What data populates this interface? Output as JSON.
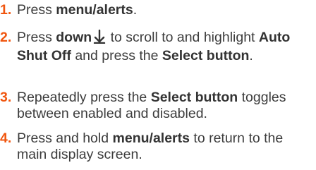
{
  "steps": [
    {
      "number": "1.",
      "text_a": "Press ",
      "bold_a": "menu/alerts",
      "text_b": "."
    },
    {
      "number": "2.",
      "text_a": "Press ",
      "bold_a": "down",
      "icon": "down-arrow-icon",
      "text_b": " to scroll to and highlight ",
      "bold_b": "Auto Shut Off",
      "text_c": " and press the ",
      "bold_c": "Select button",
      "text_d": "."
    },
    {
      "number": "3.",
      "text_a": "Repeatedly press the ",
      "bold_a": "Select button",
      "text_b": " toggles between enabled and disabled."
    },
    {
      "number": "4.",
      "text_a": "Press and hold ",
      "bold_a": "menu/alerts",
      "text_b": " to return to the main display screen."
    }
  ],
  "colors": {
    "step_number": "#f0560f",
    "text": "#3c3c3c"
  }
}
